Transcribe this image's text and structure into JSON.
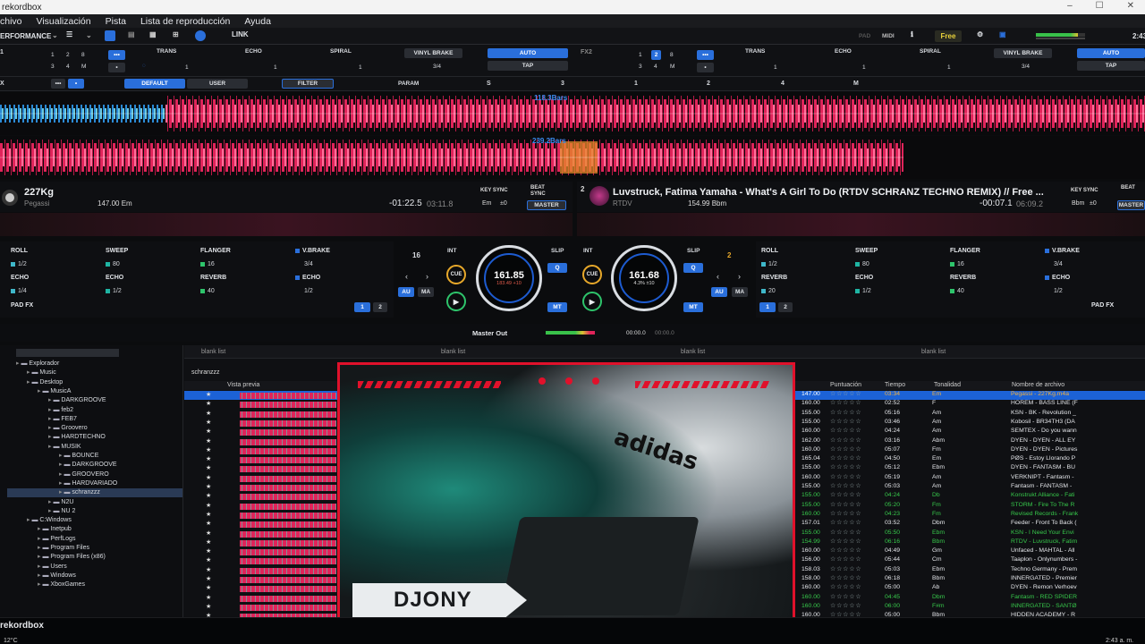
{
  "window": {
    "title": "rekordbox",
    "controls": [
      "–",
      "☐",
      "✕"
    ]
  },
  "menu": [
    "chivo",
    "Visualización",
    "Pista",
    "Lista de reproducción",
    "Ayuda"
  ],
  "toolbar": {
    "mode": "ERFORMANCE",
    "link": "LINK",
    "pad": "PAD",
    "midi": "MIDI",
    "plan": "Free",
    "clock": "2:43"
  },
  "fx1": {
    "label": "1",
    "trans": "TRANS",
    "echo": "ECHO",
    "spiral": "SPIRAL",
    "vinyl_brake": "VINYL BRAKE",
    "auto": "AUTO",
    "tap": "TAP",
    "fraction": "3/4",
    "nums": [
      "1",
      "2",
      "8",
      "3",
      "4",
      "M"
    ],
    "beat_vals": [
      "1",
      "1",
      "1"
    ]
  },
  "fx2": {
    "label": "FX2",
    "trans": "TRANS",
    "echo": "ECHO",
    "spiral": "SPIRAL",
    "vinyl_brake": "VINYL BRAKE",
    "auto": "AUTO",
    "tap": "TAP",
    "fraction": "3/4",
    "nums": [
      "1",
      "2",
      "8",
      "3",
      "4",
      "M"
    ],
    "beat_vals": [
      "1",
      "1",
      "1"
    ]
  },
  "cfx": {
    "label": "X",
    "default": "DEFAULT",
    "user": "USER",
    "filter": "FILTER",
    "param": "PARAM",
    "keys": [
      "S",
      "3",
      "1",
      "2",
      "4",
      "M"
    ]
  },
  "wave": {
    "bars1": "118.3Bars",
    "bars2": "239.2Bars"
  },
  "deck1": {
    "title": "227Kg",
    "artist": "Pegassi",
    "bpm_key": "147.00 Em",
    "time_remain": "-01:22.5",
    "time_total": "03:11.8",
    "key_sync": "KEY SYNC",
    "beat_sync": "BEAT SYNC",
    "key": "Em",
    "key_shift": "±0",
    "master": "MASTER",
    "jog_bpm": "161.85",
    "jog_sub": "183.49 +10",
    "beat_num": "16",
    "slip": "SLIP",
    "int": "INT"
  },
  "deck2": {
    "num": "2",
    "title": "Luvstruck, Fatima Yamaha - What's A Girl To Do (RTDV SCHRANZ TECHNO REMIX) // Free ...",
    "artist": "RTDV",
    "bpm_key": "154.99 Bbm",
    "time_remain": "-00:07.1",
    "time_total": "06:09.2",
    "key_sync": "KEY SYNC",
    "beat_sync": "BEAT",
    "key": "Bbm",
    "key_shift": "±0",
    "master": "MASTER",
    "jog_bpm": "161.68",
    "jog_sub": "4.3% ±10",
    "beat_num": "2",
    "slip": "SLIP",
    "int": "INT"
  },
  "pads1": [
    {
      "name": "ROLL",
      "val": "1/2",
      "color": "#3fb7c9"
    },
    {
      "name": "SWEEP",
      "val": "80",
      "color": "#1fb5a3"
    },
    {
      "name": "FLANGER",
      "val": "16",
      "color": "#2ec46b"
    },
    {
      "name": "V.BRAKE",
      "val": "3/4",
      "color": "#2a6fdb"
    },
    {
      "name": "ECHO",
      "val": "1/4",
      "color": "#3fb7c9"
    },
    {
      "name": "ECHO",
      "val": "1/2",
      "color": "#1fb5a3"
    },
    {
      "name": "REVERB",
      "val": "40",
      "color": "#2ec46b"
    },
    {
      "name": "ECHO",
      "val": "1/2",
      "color": "#2a6fdb"
    }
  ],
  "pads2": [
    {
      "name": "ROLL",
      "val": "1/2",
      "color": "#3fb7c9"
    },
    {
      "name": "SWEEP",
      "val": "80",
      "color": "#1fb5a3"
    },
    {
      "name": "FLANGER",
      "val": "16",
      "color": "#2ec46b"
    },
    {
      "name": "V.BRAKE",
      "val": "3/4",
      "color": "#2a6fdb"
    },
    {
      "name": "REVERB",
      "val": "20",
      "color": "#3fb7c9"
    },
    {
      "name": "ECHO",
      "val": "1/2",
      "color": "#1fb5a3"
    },
    {
      "name": "REVERB",
      "val": "40",
      "color": "#2ec46b"
    },
    {
      "name": "ECHO",
      "val": "1/2",
      "color": "#2a6fdb"
    }
  ],
  "padfx": {
    "label": "PAD FX",
    "page1": "1",
    "page2": "2"
  },
  "buttons": {
    "cue": "CUE",
    "au": "AU",
    "ma": "MA",
    "q": "Q",
    "mt": "MT",
    "play": "▶"
  },
  "master": {
    "label": "Master Out",
    "time1": "00:00.0",
    "time2": "00:00.0"
  },
  "browser": {
    "lists": [
      "blank list",
      "blank list",
      "blank list",
      "blank list"
    ],
    "playlist": "schranzzz",
    "col_preview": "Vista previa",
    "col_rating": "Puntuación",
    "col_time": "Tiempo",
    "col_key": "Tonalidad",
    "col_file": "Nombre de archivo"
  },
  "tree": [
    {
      "t": "Explorador",
      "lvl": 0
    },
    {
      "t": "Music",
      "lvl": 1
    },
    {
      "t": "Desktop",
      "lvl": 1
    },
    {
      "t": "MusicA",
      "lvl": 2
    },
    {
      "t": "DARKGROOVE",
      "lvl": 3
    },
    {
      "t": "feb2",
      "lvl": 3
    },
    {
      "t": "FEB7",
      "lvl": 3
    },
    {
      "t": "Groovero",
      "lvl": 3
    },
    {
      "t": "HARDTECHNO",
      "lvl": 3
    },
    {
      "t": "MUSIK",
      "lvl": 3
    },
    {
      "t": "BOUNCE",
      "lvl": 4
    },
    {
      "t": "DARKGROOVE",
      "lvl": 4
    },
    {
      "t": "GROOVERO",
      "lvl": 4
    },
    {
      "t": "HARDVARIADO",
      "lvl": 4
    },
    {
      "t": "schranzzz",
      "lvl": 4,
      "sel": true
    },
    {
      "t": "N2U",
      "lvl": 3
    },
    {
      "t": "NU 2",
      "lvl": 3
    },
    {
      "t": "C:Windows",
      "lvl": 1
    },
    {
      "t": "Inetpub",
      "lvl": 2
    },
    {
      "t": "PerfLogs",
      "lvl": 2
    },
    {
      "t": "Program Files",
      "lvl": 2
    },
    {
      "t": "Program Files (x86)",
      "lvl": 2
    },
    {
      "t": "Users",
      "lvl": 2
    },
    {
      "t": "Windows",
      "lvl": 2
    },
    {
      "t": "XboxGames",
      "lvl": 2
    }
  ],
  "tracks": [
    {
      "bpm": "147.00",
      "time": "03:34",
      "key": "Em",
      "file": "Pegassi - 227Kg.m4a",
      "c": "sel"
    },
    {
      "bpm": "160.00",
      "time": "02:52",
      "key": "F",
      "file": "HOREM - BASS LINE (F",
      "c": "w"
    },
    {
      "bpm": "155.00",
      "time": "05:16",
      "key": "Am",
      "file": "KSN - BK - Revolution _",
      "c": "w"
    },
    {
      "bpm": "155.00",
      "time": "03:46",
      "key": "Am",
      "file": "Kobosil - BR34TH3 (DA",
      "c": "w"
    },
    {
      "bpm": "160.00",
      "time": "04:24",
      "key": "Am",
      "file": "SEMTEX - Do you wann",
      "c": "w"
    },
    {
      "bpm": "162.00",
      "time": "03:16",
      "key": "Abm",
      "file": "DYEN - DYEN - ALL EY",
      "c": "w"
    },
    {
      "bpm": "160.00",
      "time": "05:07",
      "key": "Fm",
      "file": "DYEN - DYEN - Pictures",
      "c": "w"
    },
    {
      "bpm": "165.04",
      "time": "04:50",
      "key": "Em",
      "file": "PØS - Estoy Llorando P",
      "c": "w"
    },
    {
      "bpm": "155.00",
      "time": "05:12",
      "key": "Ebm",
      "file": "DYEN - FANTASM - BU",
      "c": "w"
    },
    {
      "bpm": "160.00",
      "time": "05:19",
      "key": "Am",
      "file": "VERKNIPT - Fantasm -",
      "c": "w"
    },
    {
      "bpm": "155.00",
      "time": "05:03",
      "key": "Am",
      "file": "Fantasm - FANTASM -",
      "c": "w"
    },
    {
      "bpm": "155.00",
      "time": "04:24",
      "key": "Db",
      "file": "Konstrukt Alliance - Fati",
      "c": "g"
    },
    {
      "bpm": "155.00",
      "time": "05:20",
      "key": "Fm",
      "file": "STORM - Fire To The R",
      "c": "g"
    },
    {
      "bpm": "160.00",
      "time": "04:23",
      "key": "Fm",
      "file": "Revised Records - Frank",
      "c": "g"
    },
    {
      "bpm": "157.01",
      "time": "03:52",
      "key": "Dbm",
      "file": "Feeder - Front To Back (",
      "c": "w"
    },
    {
      "bpm": "155.00",
      "time": "05:50",
      "key": "Ebm",
      "file": "KSN - I Need Your Envi",
      "c": "g"
    },
    {
      "bpm": "154.99",
      "time": "06:16",
      "key": "Bbm",
      "file": "RTDV - Luvstruck, Fatim",
      "c": "g"
    },
    {
      "bpm": "160.00",
      "time": "04:49",
      "key": "Gm",
      "file": "Unfaced - MAHTAL - All",
      "c": "w"
    },
    {
      "bpm": "156.00",
      "time": "05:44",
      "key": "Cm",
      "file": "Taaplon - Onlynumbers -",
      "c": "w"
    },
    {
      "bpm": "158.03",
      "time": "05:03",
      "key": "Ebm",
      "file": "Techno Germany - Prem",
      "c": "w"
    },
    {
      "bpm": "158.00",
      "time": "06:18",
      "key": "Bbm",
      "file": "INNERGATED - Premier",
      "c": "w"
    },
    {
      "bpm": "160.00",
      "time": "05:00",
      "key": "Ab",
      "file": "DYEN - Remon Verhoev",
      "c": "w"
    },
    {
      "bpm": "160.00",
      "time": "04:45",
      "key": "Dbm",
      "file": "Fantasm - RED SPIDER",
      "c": "g"
    },
    {
      "bpm": "160.00",
      "time": "06:00",
      "key": "F#m",
      "file": "INNERGATED - SANTØ",
      "c": "g"
    },
    {
      "bpm": "160.00",
      "time": "05:00",
      "key": "Bbm",
      "file": "HIDDEN ACADEMY - R",
      "c": "w"
    }
  ],
  "overlay": {
    "name": "DJONY"
  },
  "taskbar": {
    "app": "rekordbox",
    "weather": "12°C",
    "time": "2:43 a. m."
  },
  "colors": {
    "accent": "#2a6fdb",
    "wave": "#e0245a",
    "hud": "#e0112b",
    "row_green": "#37c94b",
    "row_sel": "#1c62d6"
  }
}
